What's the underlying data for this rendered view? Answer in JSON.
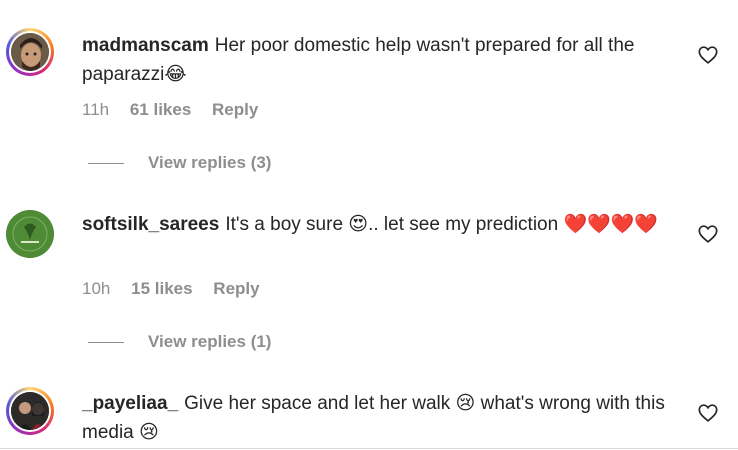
{
  "comments": [
    {
      "username": "madmanscam",
      "text": "Her poor domestic help wasn't prepared for all the paparazzi😂",
      "time": "11h",
      "likes": "61 likes",
      "reply": "Reply",
      "view_replies": "View replies (3)",
      "avatar": "portrait-photo"
    },
    {
      "username": "softsilk_sarees",
      "text": "It's a boy sure 😍.. let see my prediction ❤️❤️❤️❤️",
      "time": "10h",
      "likes": "15 likes",
      "reply": "Reply",
      "view_replies": "View replies (1)",
      "avatar": "green-logo"
    },
    {
      "username": "_payeliaa_",
      "text": "Give her space and let her walk 😢 what's wrong with this media 😢",
      "avatar": "couple-photo"
    }
  ],
  "icons": {
    "like": "heart-outline-icon"
  },
  "colors": {
    "text": "#262626",
    "muted": "#8e8e8e",
    "story_ring": "#d62976"
  }
}
